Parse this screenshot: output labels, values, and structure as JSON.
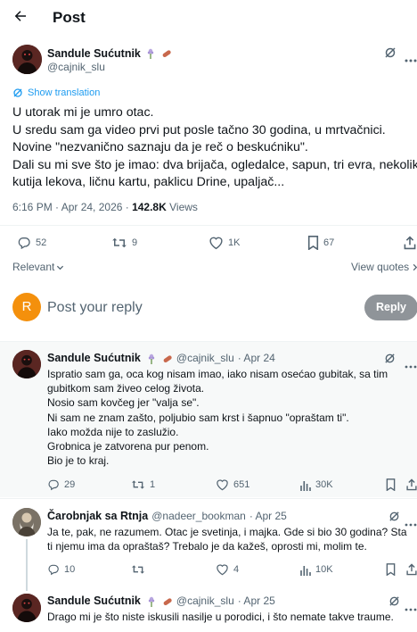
{
  "header": {
    "back_icon": "arrow-left-icon",
    "title": "Post"
  },
  "post": {
    "author_name": "Sandule Sućutnik",
    "author_handle": "@cajnik_slu",
    "show_translation": "Show translation",
    "lines": [
      "U utorak mi je umro otac.",
      "U sredu sam ga video prvi put posle tačno 30 godina, u mrtvačnici.",
      "Novine \"nezvanično saznaju da je reč o beskućniku\".",
      "Dali su mi sve što je imao: dva brijača, ogledalce, sapun, tri evra, nekoliko",
      "kutija lekova, ličnu kartu, paklicu Drine, upaljač..."
    ],
    "time": "6:16 PM · Apr 24, 2026 · ",
    "views_count": "142.8K",
    "views_label": " Views",
    "replies": "52",
    "reposts": "9",
    "likes": "1K",
    "bookmarks": "67",
    "sort_label": "Relevant",
    "view_quotes": "View quotes"
  },
  "composer": {
    "avatar_letter": "R",
    "avatar_color": "#f4900c",
    "placeholder": "Post your reply",
    "button": "Reply"
  },
  "replies": [
    {
      "name": "Sandule Sućutnik",
      "handle": "@cajnik_slu",
      "date": "· Apr 24",
      "lines": [
        "Ispratio sam ga, oca kog nisam imao, iako nisam osećao gubitak, sa tim",
        "gubitkom sam živeo celog života.",
        "Nosio sam kovčeg jer \"valja se\".",
        "Ni sam ne znam zašto, poljubio sam krst i šapnuo \"opraštam ti\".",
        "Iako možda nije to zaslužio.",
        "Grobnica je zatvorena pur penom.",
        "Bio je to kraj."
      ],
      "replies": "29",
      "reposts": "1",
      "likes": "651",
      "views": "30K"
    },
    {
      "name": "Čarobnjak sa Rtnja",
      "handle": "@nadeer_bookman",
      "date": "· Apr 25",
      "lines": [
        "Ja te, pak, ne razumem. Otac je svetinja, i majka. Gde si bio 30 godina? Sta",
        "ti njemu ima da opraštaš? Trebalo je da kažeš, oprosti mi, molim te."
      ],
      "replies": "10",
      "reposts": "",
      "likes": "4",
      "views": "10K"
    },
    {
      "name": "Sandule Sućutnik",
      "handle": "@cajnik_slu",
      "date": "· Apr 25",
      "lines": [
        "Drago mi je što niste iskusili nasilje u porodici, i što nemate takve traume."
      ]
    }
  ],
  "colors": {
    "accent": "#1d9bf0",
    "text": "#0f1419",
    "muted": "#536471"
  }
}
